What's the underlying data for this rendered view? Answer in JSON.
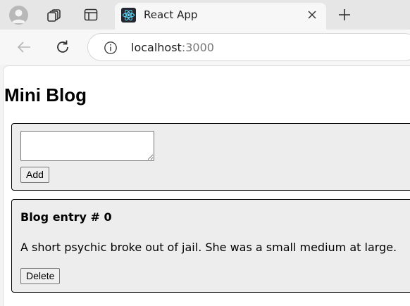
{
  "browser": {
    "tab": {
      "title": "React App",
      "favicon": "react-logo-icon"
    },
    "address": {
      "host": "localhost",
      "port": ":3000"
    },
    "icons": [
      "profile-icon",
      "workspaces-icon",
      "tab-actions-icon",
      "close-icon",
      "new-tab-icon",
      "back-icon",
      "refresh-icon",
      "info-icon"
    ]
  },
  "page": {
    "title": "Mini Blog",
    "composer": {
      "textarea_value": "",
      "add_label": "Add"
    },
    "entries": [
      {
        "heading": "Blog entry # 0",
        "body": "A short psychic broke out of jail. She was a small medium at large.",
        "delete_label": "Delete"
      }
    ]
  },
  "colors": {
    "accent_react": "#61dafb",
    "chrome_bg": "#e6e6e6",
    "panel_bg": "#ededed"
  }
}
